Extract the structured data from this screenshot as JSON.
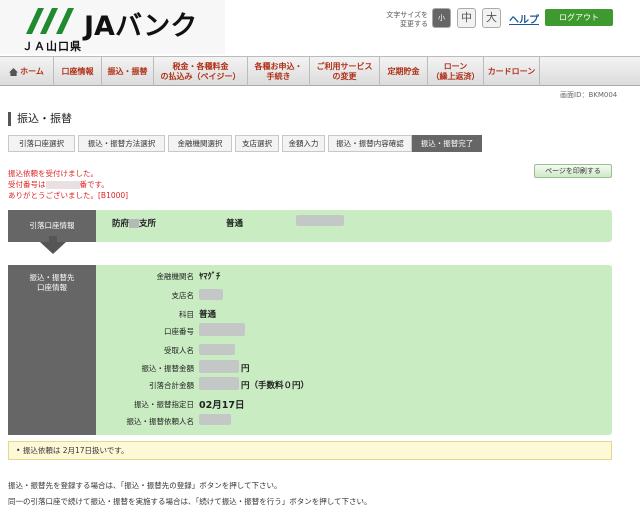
{
  "header": {
    "logo_text": "JAバンク",
    "logo_sub": "ＪＡ山口県",
    "font_size_label_1": "文字サイズを",
    "font_size_label_2": "変更する",
    "font_small": "小",
    "font_mid": "中",
    "font_big": "大",
    "help": "ヘルプ",
    "logout": "ログアウト"
  },
  "nav": {
    "items": [
      {
        "label": "ホーム"
      },
      {
        "label": "口座情報"
      },
      {
        "label": "振込・振替"
      },
      {
        "label": "税金・各種料金\nの払込み（ペイジー）"
      },
      {
        "label": "各種お申込・\n手続き"
      },
      {
        "label": "ご利用サービス\nの変更"
      },
      {
        "label": "定期貯金"
      },
      {
        "label": "ローン\n（繰上返済）"
      },
      {
        "label": "カードローン"
      }
    ]
  },
  "screen_id": "画面ID：BKM004",
  "page_title": "振込・振替",
  "steps": [
    {
      "label": "引落口座選択"
    },
    {
      "label": "振込・振替方法選択"
    },
    {
      "label": "金融機関選択"
    },
    {
      "label": "支店選択"
    },
    {
      "label": "金額入力"
    },
    {
      "label": "振込・振替内容確認"
    },
    {
      "label": "振込・振替完了"
    }
  ],
  "message": {
    "line1": "振込依頼を受付けました。",
    "line2_prefix": "受付番号は",
    "line2_suffix": "番です。",
    "line3": "ありがとうございました。[B1000]"
  },
  "print_button": "ページを印刷する",
  "source_account": {
    "label": "引落口座情報",
    "branch_prefix": "防府",
    "branch_suffix": "支所",
    "type": "普通"
  },
  "destination": {
    "label_line1": "振込・振替先",
    "label_line2": "口座情報",
    "rows": [
      {
        "label": "金融機関名",
        "value": "ﾔﾏｸﾞﾁ"
      },
      {
        "label": "支店名",
        "value": ""
      },
      {
        "label": "科目",
        "value": "普通"
      },
      {
        "label": "口座番号",
        "value": ""
      },
      {
        "label": "受取人名",
        "value": ""
      },
      {
        "label": "振込・振替金額",
        "value": "円"
      },
      {
        "label": "引落合計金額",
        "value": "円（手数料０円）"
      },
      {
        "label": "振込・振替指定日",
        "value": "02月17日"
      },
      {
        "label": "振込・振替依頼人名",
        "value": ""
      }
    ]
  },
  "notice": "振込依頼は 2月17日扱いです。",
  "footer": {
    "line1": "振込・振替先を登録する場合は、「振込・振替先の登録」ボタンを押して下さい。",
    "line2": "同一の引落口座で続けて振込・振替を実施する場合は、「続けて振込・振替を行う」ボタンを押して下さい。"
  },
  "colors": {
    "accent_green": "#3e9a2e",
    "panel_green": "#c9ecc2",
    "label_gray": "#666666",
    "message_red": "#dd2222",
    "nav_text": "#b03018"
  }
}
